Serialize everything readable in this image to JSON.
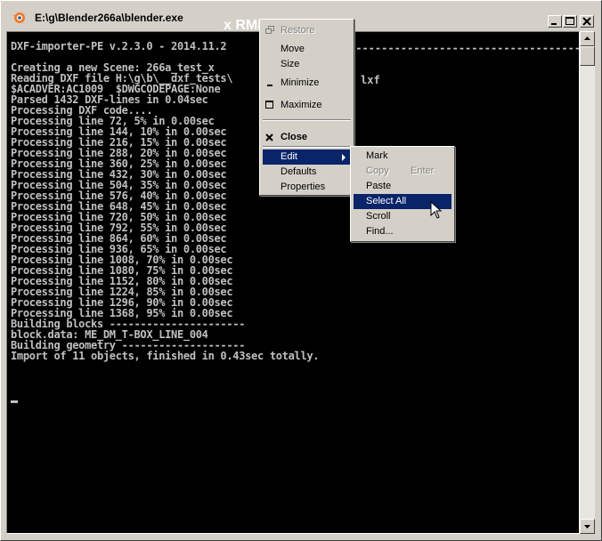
{
  "window": {
    "title": "E:\\g\\Blender266a\\blender.exe",
    "annotation": "x RMB"
  },
  "console": {
    "lines": [
      "DXF-importer-PE v.2.3.0 - 2014.11.2",
      "",
      "Creating a new Scene: 266a_test_x",
      "Reading DXF file H:\\g\\b\\__dxf_tests\\",
      "$ACADVER:AC1009  $DWGCODEPAGE:None",
      "Parsed 1432 DXF-lines in 0.04sec",
      "Processing DXF code....",
      "Processing line 72, 5% in 0.00sec",
      "Processing line 144, 10% in 0.00sec",
      "Processing line 216, 15% in 0.00sec",
      "Processing line 288, 20% in 0.00sec",
      "Processing line 360, 25% in 0.00sec",
      "Processing line 432, 30% in 0.00sec",
      "Processing line 504, 35% in 0.00sec",
      "Processing line 576, 40% in 0.00sec",
      "Processing line 648, 45% in 0.00sec",
      "Processing line 720, 50% in 0.00sec",
      "Processing line 792, 55% in 0.00sec",
      "Processing line 864, 60% in 0.00sec",
      "Processing line 936, 65% in 0.00sec",
      "Processing line 1008, 70% in 0.00sec",
      "Processing line 1080, 75% in 0.00sec",
      "Processing line 1152, 80% in 0.00sec",
      "Processing line 1224, 85% in 0.00sec",
      "Processing line 1296, 90% in 0.00sec",
      "Processing line 1368, 95% in 0.00sec",
      "Building blocks ----------------------",
      "block.data: ME_DM_T-BOX_LINE_004",
      "Building geometry --------------------",
      "Import of 11 objects, finished in 0.43sec totally."
    ],
    "line_tail_1": "------------------------------------------",
    "line_tail_4": "lxf"
  },
  "system_menu": {
    "restore": "Restore",
    "move": "Move",
    "size": "Size",
    "minimize": "Minimize",
    "maximize": "Maximize",
    "close": "Close",
    "edit": "Edit",
    "defaults": "Defaults",
    "properties": "Properties"
  },
  "edit_menu": {
    "mark": "Mark",
    "copy": "Copy",
    "copy_shortcut": "Enter",
    "paste": "Paste",
    "select_all": "Select All",
    "scroll": "Scroll",
    "find": "Find..."
  },
  "colors": {
    "highlight": "#0a246a",
    "console_bg": "#000000",
    "console_fg": "#c0c0c0"
  }
}
